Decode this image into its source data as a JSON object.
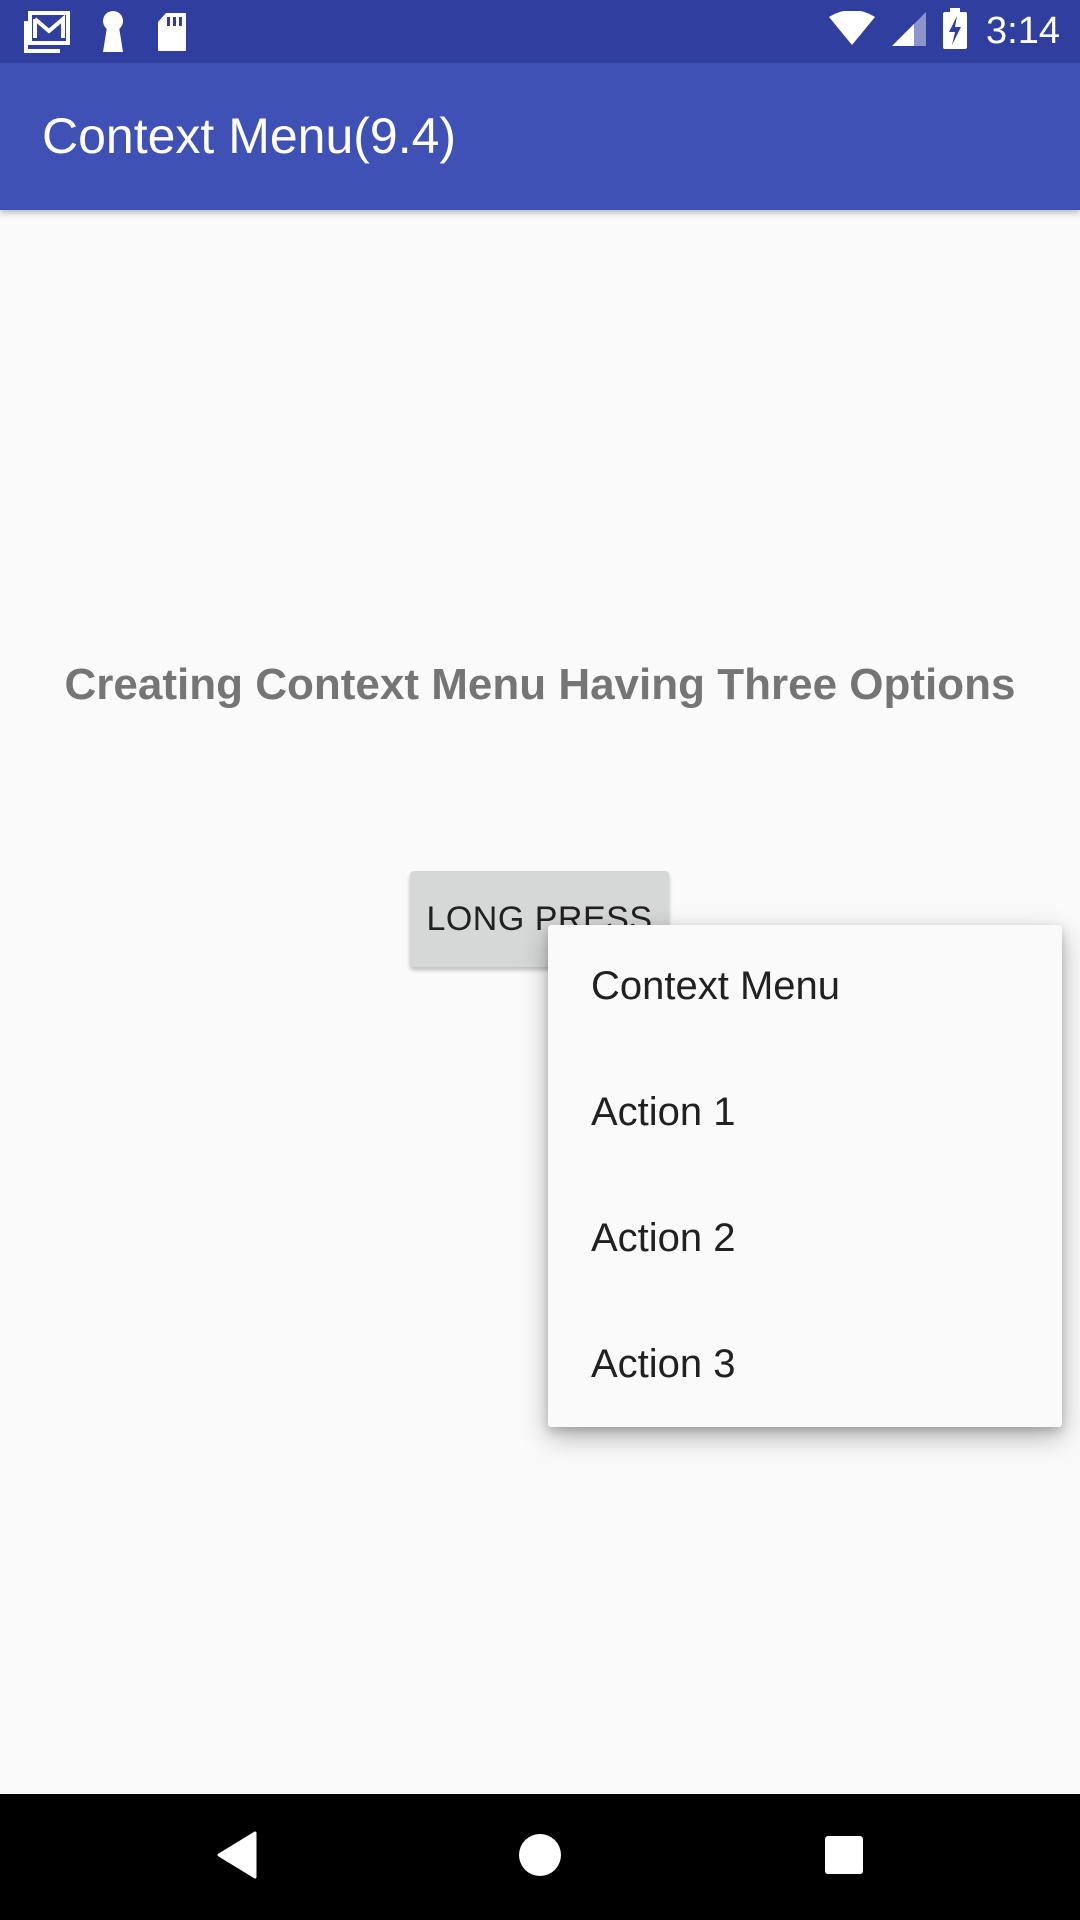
{
  "status_bar": {
    "time": "3:14",
    "icons": [
      "gmail-icon",
      "keyhole-icon",
      "sd-card-icon",
      "wifi-icon",
      "cell-signal-icon",
      "battery-charging-icon"
    ]
  },
  "app_bar": {
    "title": "Context Menu(9.4)"
  },
  "main": {
    "heading": "Creating Context Menu Having Three Options",
    "button_label": "LONG PRESS"
  },
  "context_menu": {
    "items": [
      {
        "label": "Context Menu"
      },
      {
        "label": "Action 1"
      },
      {
        "label": "Action 2"
      },
      {
        "label": "Action 3"
      }
    ]
  },
  "nav_bar": {
    "buttons": [
      "back-icon",
      "home-icon",
      "recents-icon"
    ]
  },
  "colors": {
    "status_bar": "#303f9f",
    "app_bar": "#3f51b5",
    "background": "#fafafa",
    "heading_text": "#757575",
    "button_bg": "#d6d7d7"
  }
}
